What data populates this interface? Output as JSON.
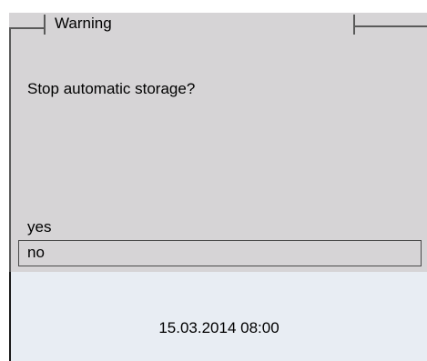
{
  "dialog": {
    "title": "Warning",
    "message": "Stop automatic storage?",
    "options": [
      {
        "label": "yes",
        "selected": false
      },
      {
        "label": "no",
        "selected": true
      }
    ]
  },
  "status_bar": {
    "datetime": "15.03.2014 08:00"
  },
  "colors": {
    "dialog_background": "#d6d4d6",
    "status_background": "#e8edf3",
    "frame": "#5a5a5a"
  }
}
